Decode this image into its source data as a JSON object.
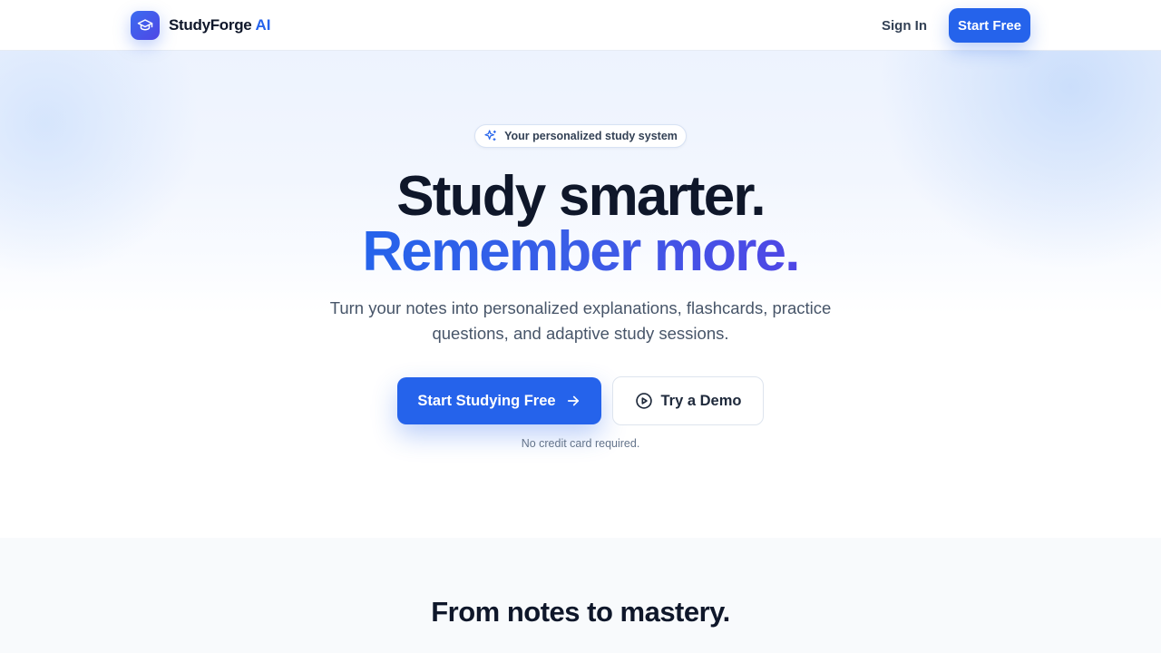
{
  "header": {
    "brand_name": "StudyForge",
    "brand_accent": "AI",
    "sign_in": "Sign In",
    "start_free": "Start Free"
  },
  "hero": {
    "badge": "Your personalized study system",
    "headline_line1": "Study smarter.",
    "headline_line2": "Remember more.",
    "subtitle": "Turn your notes into personalized explanations, flashcards, practice questions, and adaptive study sessions.",
    "primary_cta": "Start Studying Free",
    "secondary_cta": "Try a Demo",
    "note": "No credit card required."
  },
  "features": {
    "title": "From notes to mastery."
  },
  "icons": {
    "logo": "graduation-cap-icon",
    "badge": "sparkles-icon",
    "primary_cta": "arrow-right-icon",
    "secondary_cta": "play-circle-icon"
  },
  "colors": {
    "primary": "#2563eb",
    "accent_gradient_end": "#4f46e5",
    "heading": "#0f172a",
    "body_text": "#475569",
    "section_bg": "#f8fafc"
  }
}
